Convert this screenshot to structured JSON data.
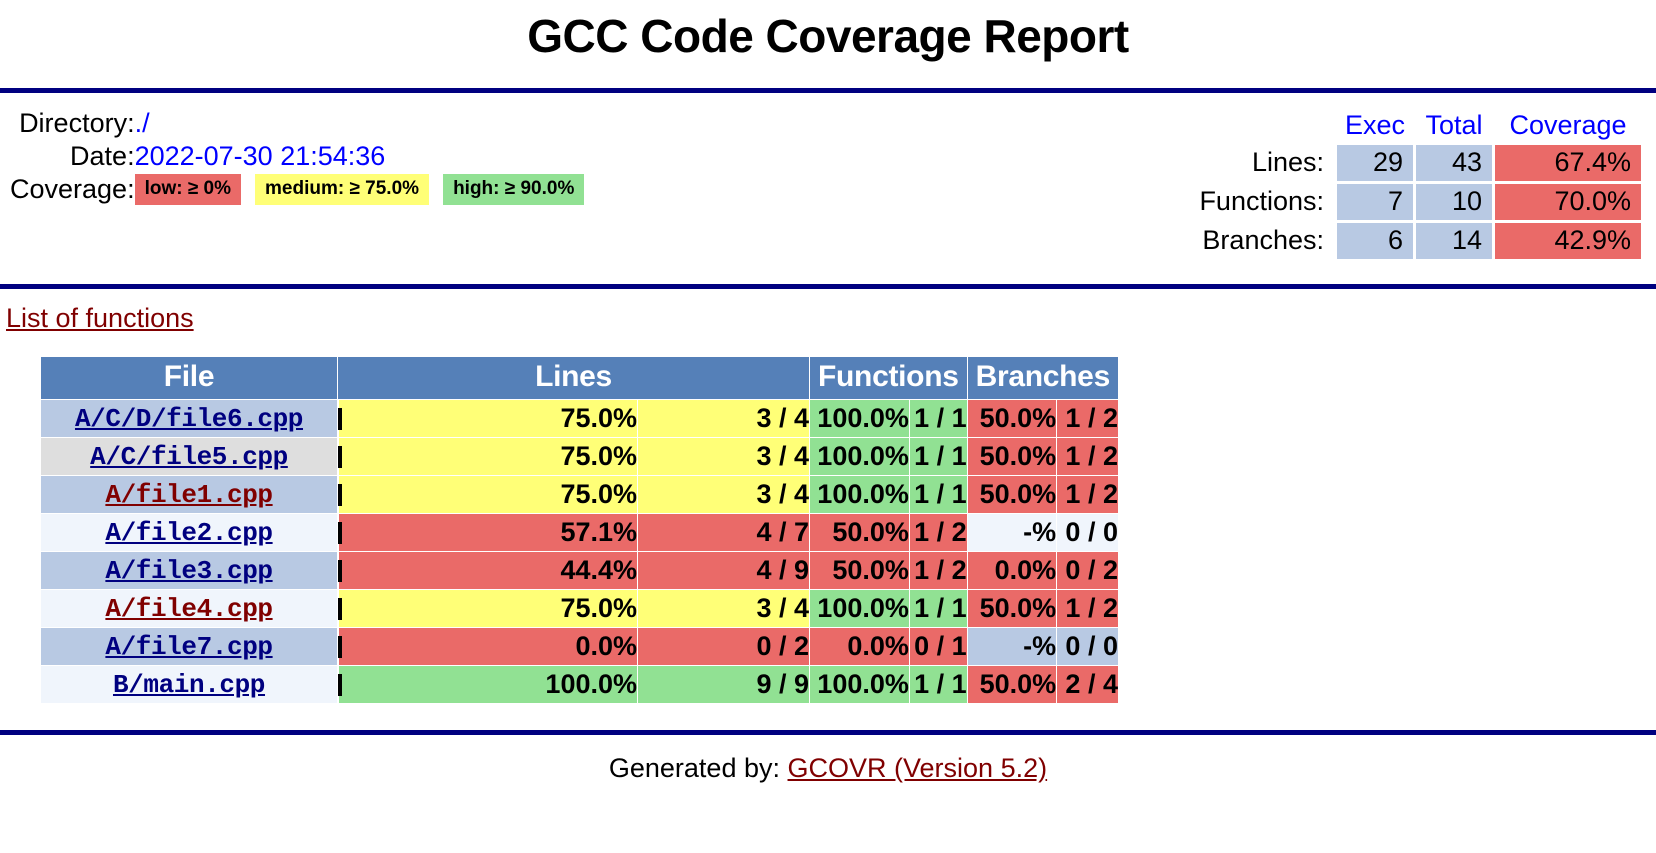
{
  "header": {
    "title": "GCC Code Coverage Report"
  },
  "summary": {
    "directory_label": "Directory:",
    "directory_value": "./",
    "date_label": "Date:",
    "date_value": "2022-07-30 21:54:36",
    "coverage_label": "Coverage:",
    "legend": [
      {
        "name": "low-legend-chip",
        "text": "low: ≥ 0%",
        "level": "low"
      },
      {
        "name": "medium-legend-chip",
        "text": "medium: ≥ 75.0%",
        "level": "medium"
      },
      {
        "name": "high-legend-chip",
        "text": "high: ≥ 90.0%",
        "level": "high"
      }
    ],
    "stats_headers": {
      "exec": "Exec",
      "total": "Total",
      "coverage": "Coverage"
    },
    "stats_rows": [
      {
        "label": "Lines:",
        "exec": "29",
        "total": "43",
        "coverage": "67.4%",
        "level": "low"
      },
      {
        "label": "Functions:",
        "exec": "7",
        "total": "10",
        "coverage": "70.0%",
        "level": "low"
      },
      {
        "label": "Branches:",
        "exec": "6",
        "total": "14",
        "coverage": "42.9%",
        "level": "low"
      }
    ]
  },
  "functions_link": "List of functions",
  "table": {
    "headers": {
      "file": "File",
      "lines": "Lines",
      "functions": "Functions",
      "branches": "Branches"
    },
    "rows": [
      {
        "file": "A/C/D/file6.cpp",
        "file_visited": false,
        "stripe": "a",
        "lines_pct": "75.0%",
        "lines_num": "3 / 4",
        "lines_level": "medium",
        "lines_bar": 75.0,
        "func_pct": "100.0%",
        "func_num": "1 / 1",
        "func_level": "high",
        "bran_pct": "50.0%",
        "bran_num": "1 / 2",
        "bran_level": "low"
      },
      {
        "file": "A/C/file5.cpp",
        "file_visited": false,
        "stripe": "b",
        "lines_pct": "75.0%",
        "lines_num": "3 / 4",
        "lines_level": "medium",
        "lines_bar": 75.0,
        "func_pct": "100.0%",
        "func_num": "1 / 1",
        "func_level": "high",
        "bran_pct": "50.0%",
        "bran_num": "1 / 2",
        "bran_level": "low"
      },
      {
        "file": "A/file1.cpp",
        "file_visited": true,
        "stripe": "a",
        "lines_pct": "75.0%",
        "lines_num": "3 / 4",
        "lines_level": "medium",
        "lines_bar": 75.0,
        "func_pct": "100.0%",
        "func_num": "1 / 1",
        "func_level": "high",
        "bran_pct": "50.0%",
        "bran_num": "1 / 2",
        "bran_level": "low"
      },
      {
        "file": "A/file2.cpp",
        "file_visited": false,
        "stripe": "c",
        "lines_pct": "57.1%",
        "lines_num": "4 / 7",
        "lines_level": "low",
        "lines_bar": 57.1,
        "func_pct": "50.0%",
        "func_num": "1 / 2",
        "func_level": "low",
        "bran_pct": "-%",
        "bran_num": "0 / 0",
        "bran_level": "none"
      },
      {
        "file": "A/file3.cpp",
        "file_visited": false,
        "stripe": "a",
        "lines_pct": "44.4%",
        "lines_num": "4 / 9",
        "lines_level": "low",
        "lines_bar": 44.4,
        "func_pct": "50.0%",
        "func_num": "1 / 2",
        "func_level": "low",
        "bran_pct": "0.0%",
        "bran_num": "0 / 2",
        "bran_level": "low"
      },
      {
        "file": "A/file4.cpp",
        "file_visited": true,
        "stripe": "c",
        "lines_pct": "75.0%",
        "lines_num": "3 / 4",
        "lines_level": "medium",
        "lines_bar": 75.0,
        "func_pct": "100.0%",
        "func_num": "1 / 1",
        "func_level": "high",
        "bran_pct": "50.0%",
        "bran_num": "1 / 2",
        "bran_level": "low"
      },
      {
        "file": "A/file7.cpp",
        "file_visited": false,
        "stripe": "a",
        "lines_pct": "0.0%",
        "lines_num": "0 / 2",
        "lines_level": "zero",
        "lines_bar": 0.0,
        "func_pct": "0.0%",
        "func_num": "0 / 1",
        "func_level": "low",
        "bran_pct": "-%",
        "bran_num": "0 / 0",
        "bran_level": "none"
      },
      {
        "file": "B/main.cpp",
        "file_visited": false,
        "stripe": "c",
        "lines_pct": "100.0%",
        "lines_num": "9 / 9",
        "lines_level": "high",
        "lines_bar": 100.0,
        "func_pct": "100.0%",
        "func_num": "1 / 1",
        "func_level": "high",
        "bran_pct": "50.0%",
        "bran_num": "2 / 4",
        "bran_level": "low"
      }
    ]
  },
  "footer": {
    "generated_by": "Generated by:",
    "tool_link": "GCOVR (Version 5.2)"
  },
  "colors": {
    "low": "#ea6a68",
    "medium": "#ffff77",
    "high": "#91e193",
    "header_bar": "#5580b8",
    "rule": "#000080",
    "link": "#000080",
    "visited_link": "#800000",
    "stat_cell": "#b8c9e3"
  }
}
